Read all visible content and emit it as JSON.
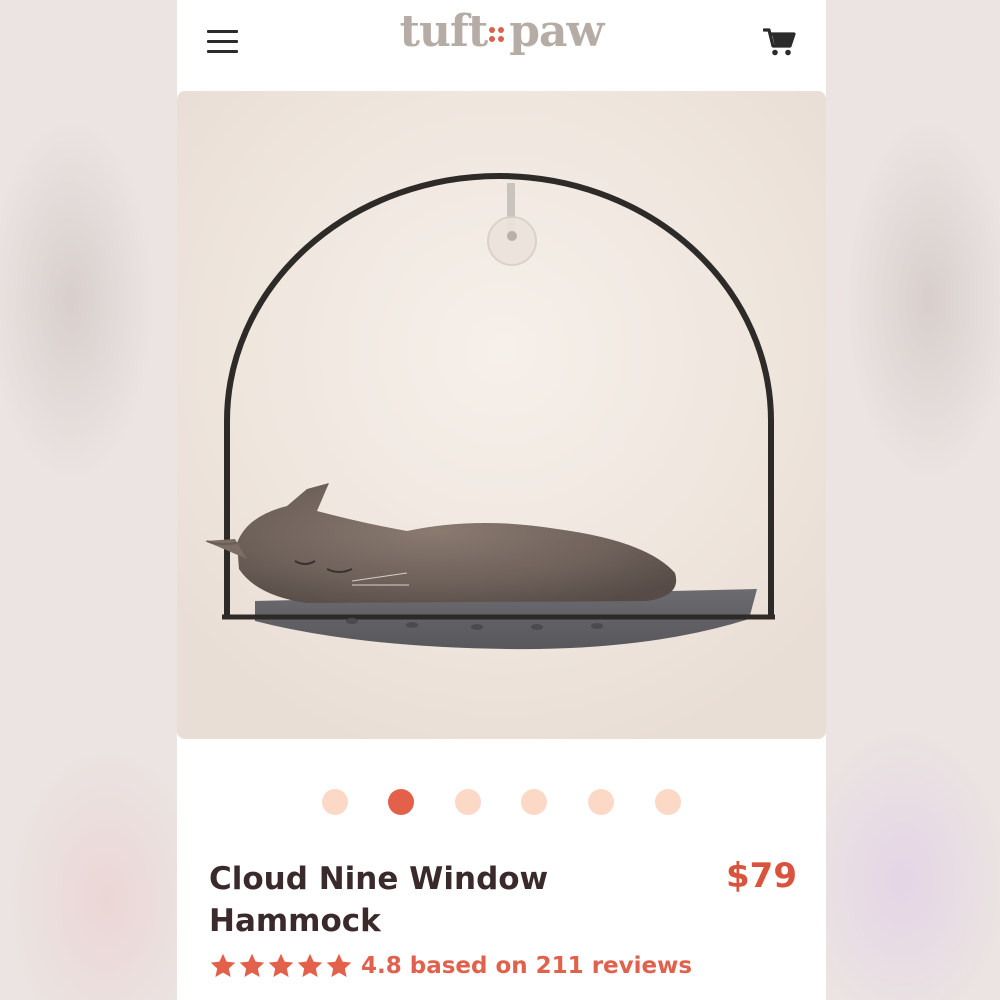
{
  "header": {
    "logo_left": "tuft",
    "logo_right": "paw",
    "menu_icon": "hamburger-menu-icon",
    "cart_icon": "shopping-cart-icon"
  },
  "gallery": {
    "image_alt": "Grey cat sleeping on a felt window hammock with a black arched frame and suction cup",
    "slide_count": 6,
    "active_index": 1
  },
  "product": {
    "title": "Cloud Nine Window Hammock",
    "price": "$79",
    "rating_value": "4.8",
    "rating_text": "4.8 based on 211 reviews",
    "review_count": "211",
    "stars": 5
  },
  "colors": {
    "accent": "#e3604a",
    "dot_inactive": "#fbd9c6",
    "price": "#d9533d",
    "title": "#3a2a2c",
    "logo": "#b6aca6"
  }
}
